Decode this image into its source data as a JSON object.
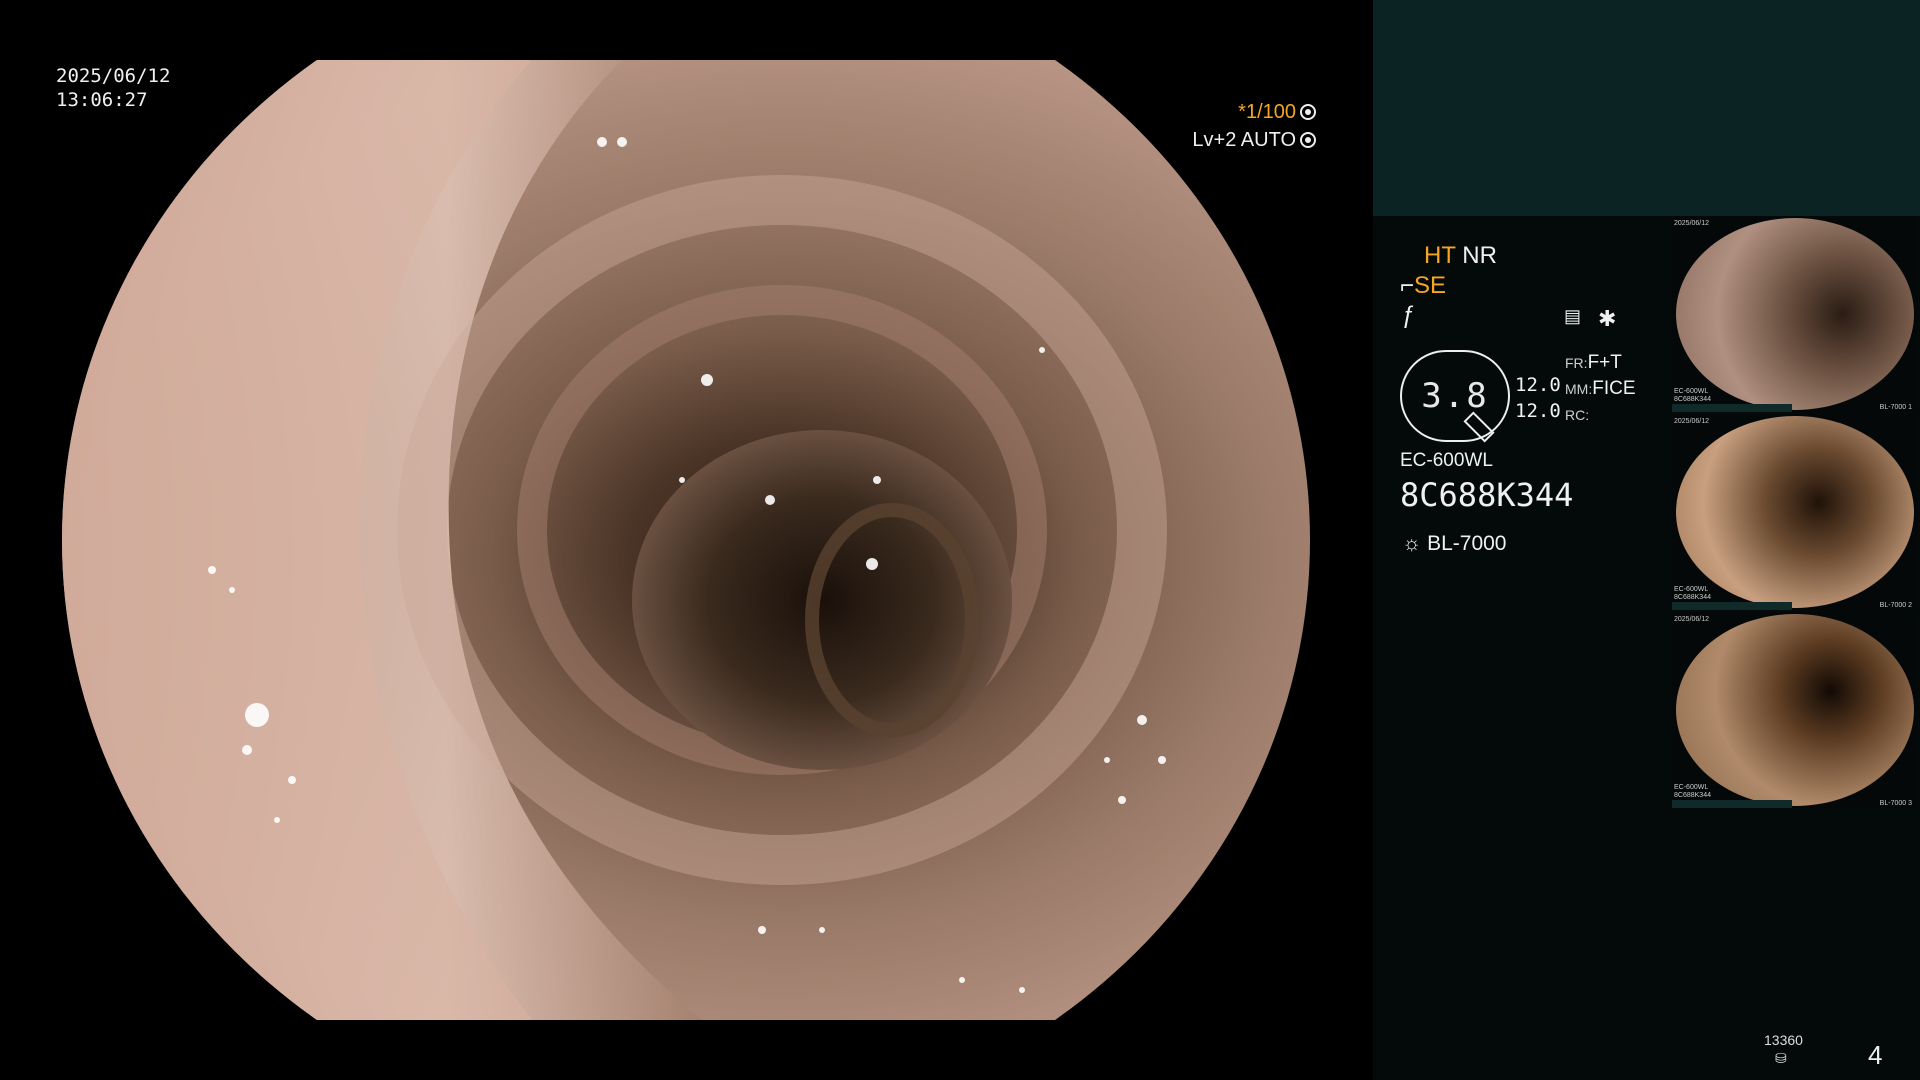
{
  "overlay": {
    "date": "2025/06/12",
    "time": "13:06:27",
    "shutter": "*1/100",
    "level": "Lv+2 AUTO"
  },
  "panel": {
    "ht": "HT",
    "nr": "NR",
    "se": "SE",
    "magnification": "3.8",
    "val1": "12.0",
    "val2": "12.0",
    "fr_label": "FR:",
    "fr_value": "F+T",
    "mm_label": "MM:",
    "mm_value": "FICE",
    "rc_label": "RC:",
    "scope_model": "EC-600WL",
    "serial": "8C688K344",
    "light_source": "BL-7000",
    "storage_count": "13360",
    "image_count": "4"
  },
  "thumbnails": [
    {
      "date": "2025/06/12",
      "model": "EC-600WL",
      "serial": "8C688K344",
      "light": "BL-7000",
      "index": "1"
    },
    {
      "date": "2025/06/12",
      "model": "EC-600WL",
      "serial": "8C688K344",
      "light": "BL-7000",
      "index": "2"
    },
    {
      "date": "2025/06/12",
      "model": "EC-600WL",
      "serial": "8C688K344",
      "light": "BL-7000",
      "index": "3"
    }
  ],
  "colors": {
    "accent": "#f5a623",
    "panel_bg": "#040a0a",
    "panel_header": "#0c2323"
  }
}
